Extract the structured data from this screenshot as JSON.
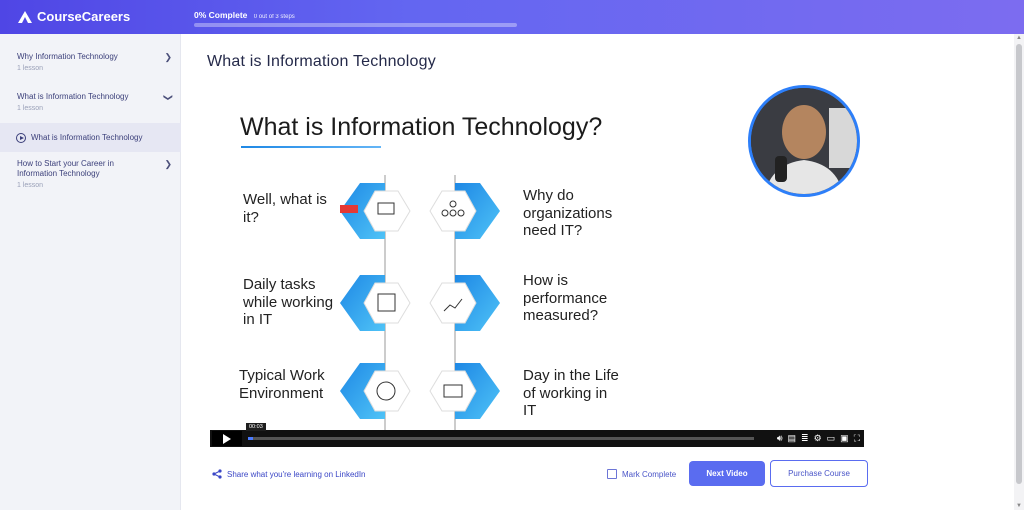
{
  "app": {
    "brand": "CourseCareers"
  },
  "progress": {
    "title": "0% Complete",
    "steps": "0 out of 3 steps",
    "value_fraction": 0.0
  },
  "sidebar": {
    "items": [
      {
        "title": "Why Information Technology",
        "sub": "1 lesson",
        "icon": "chevron-right-icon"
      },
      {
        "title": "What is Information Technology",
        "sub": "1 lesson",
        "icon": "chevron-down-icon"
      },
      {
        "title": "How to Start your Career in Information Technology",
        "sub": "1 lesson",
        "icon": "chevron-right-icon"
      }
    ],
    "active_lesson": "What is Information Technology"
  },
  "lesson": {
    "heading": "What is Information Technology"
  },
  "video": {
    "slide_title": "What is Information Technology?",
    "topics": {
      "t1": "Well, what is it?",
      "t2": "Why do organizations need IT?",
      "t3": "Daily tasks while working in IT",
      "t4": "How is performance measured?",
      "t5": "Typical Work Environment",
      "t6": "Day in the Life of working in IT"
    },
    "current_time": "00:03",
    "played_fraction": 0.01,
    "icons": [
      "play-icon",
      "volume-icon",
      "captions-icon",
      "transcript-icon",
      "settings-icon",
      "cast-icon",
      "pip-icon",
      "fullscreen-icon"
    ]
  },
  "actions": {
    "share": "Share what you're learning on LinkedIn",
    "mark_complete": "Mark Complete",
    "next": "Next Video",
    "purchase": "Purchase Course"
  },
  "colors": {
    "accent": "#5a6cf0",
    "topbar_start": "#4f46e5",
    "topbar_end": "#7c6cf0",
    "slide_blue": "#1e88e5"
  }
}
